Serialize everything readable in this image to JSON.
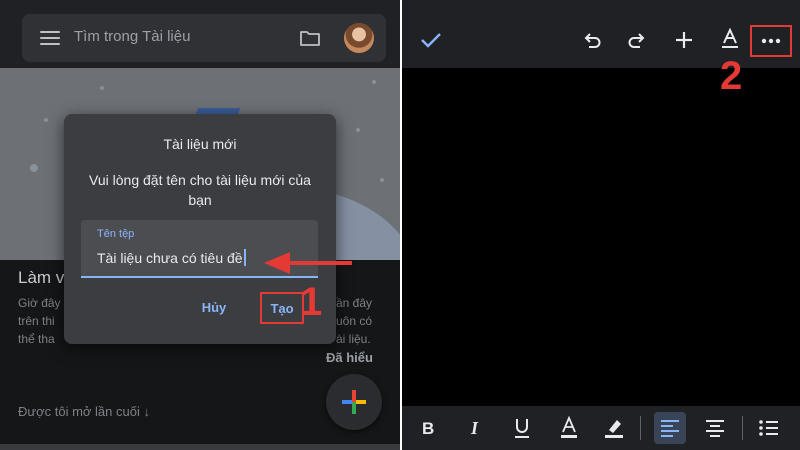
{
  "left_panel": {
    "search": {
      "placeholder": "Tìm trong Tài liệu"
    },
    "icons": {
      "menu": "menu-icon",
      "folder": "folder-icon",
      "avatar": "avatar-icon"
    },
    "onboarding": {
      "title": "Làm v",
      "body_left": [
        "Giờ đây",
        "trên thi",
        "thể tha"
      ],
      "body_right": [
        "ần đây",
        "uôn có",
        "ài liệu."
      ],
      "dismiss": "Đã hiểu"
    },
    "recent_label": "Được tôi mở lần cuối ↓",
    "fab_icon": "plus-colorful-icon",
    "dialog": {
      "title": "Tài liệu mới",
      "message": "Vui lòng đặt tên cho tài liệu mới của bạn",
      "field_label": "Tên tệp",
      "field_value": "Tài liệu chưa có tiêu đề",
      "cancel": "Hủy",
      "create": "Tạo"
    },
    "annotation_number": "1"
  },
  "right_panel": {
    "top_icons": [
      "check-icon",
      "undo-icon",
      "redo-icon",
      "add-icon",
      "text-format-icon",
      "more-icon"
    ],
    "bottom_icons": [
      "bold-icon",
      "italic-icon",
      "underline-icon",
      "text-color-icon",
      "highlight-icon",
      "align-left-icon",
      "align-center-icon",
      "bulleted-list-icon"
    ],
    "annotation_number": "2"
  },
  "colors": {
    "accent": "#8ab4f8",
    "annotation": "#e53935",
    "surface": "#202124",
    "dialog": "#3c3d40"
  }
}
